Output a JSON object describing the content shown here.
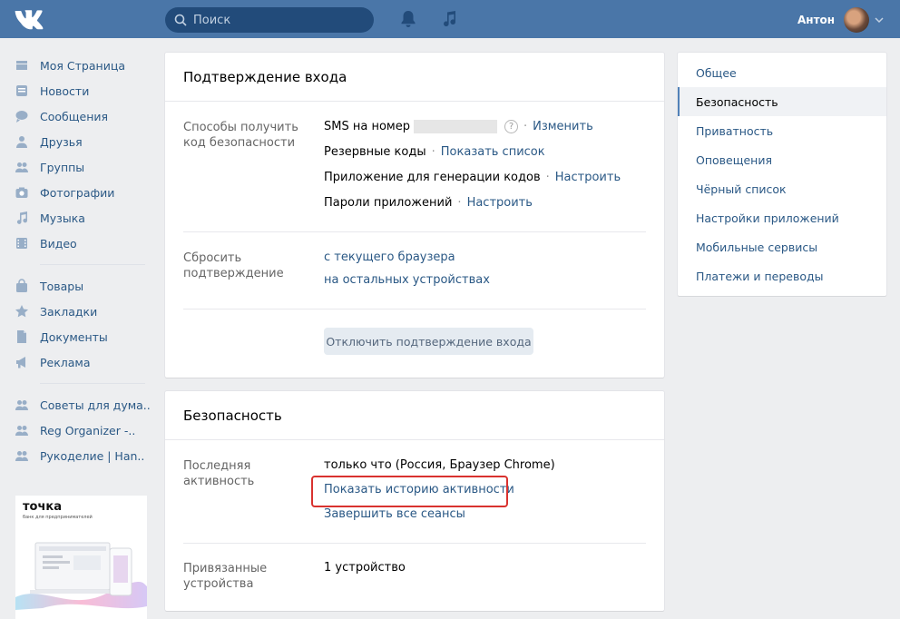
{
  "header": {
    "search_placeholder": "Поиск",
    "user_name": "Антон"
  },
  "leftnav": {
    "group1": [
      {
        "label": "Моя Страница",
        "icon": "home-icon"
      },
      {
        "label": "Новости",
        "icon": "news-icon"
      },
      {
        "label": "Сообщения",
        "icon": "messages-icon"
      },
      {
        "label": "Друзья",
        "icon": "friends-icon"
      },
      {
        "label": "Группы",
        "icon": "groups-icon"
      },
      {
        "label": "Фотографии",
        "icon": "camera-icon"
      },
      {
        "label": "Музыка",
        "icon": "music-icon"
      },
      {
        "label": "Видео",
        "icon": "video-icon"
      }
    ],
    "group2": [
      {
        "label": "Товары",
        "icon": "bag-icon"
      },
      {
        "label": "Закладки",
        "icon": "star-icon"
      },
      {
        "label": "Документы",
        "icon": "document-icon"
      },
      {
        "label": "Реклама",
        "icon": "megaphone-icon"
      }
    ],
    "group3": [
      {
        "label": "Советы для дума..",
        "icon": "group-icon"
      },
      {
        "label": "Reg Organizer -..",
        "icon": "group-icon"
      },
      {
        "label": "Рукоделие | Han..",
        "icon": "group-icon"
      }
    ],
    "ad_brand": "точка",
    "ad_tagline": "банк для предпринимателей"
  },
  "login_confirm": {
    "title": "Подтверждение входа",
    "methods_label": "Способы получить код безопасности",
    "sms_label": "SMS на номер",
    "sms_action": "Изменить",
    "backup_label": "Резервные коды",
    "backup_action": "Показать список",
    "app_label": "Приложение для генерации кодов",
    "app_action": "Настроить",
    "passwords_label": "Пароли приложений",
    "passwords_action": "Настроить",
    "reset_label": "Сбросить подтверждение",
    "reset_current": "с текущего браузера",
    "reset_other": "на остальных устройствах",
    "disable_button": "Отключить подтверждение входа"
  },
  "security": {
    "title": "Безопасность",
    "last_activity_label": "Последняя активность",
    "last_activity_value": "только что (Россия, Браузер Chrome)",
    "show_history": "Показать историю активности",
    "end_sessions": "Завершить все сеансы",
    "devices_label": "Привязанные устройства",
    "devices_value": "1 устройство"
  },
  "right_menu": {
    "items": [
      "Общее",
      "Безопасность",
      "Приватность",
      "Оповещения",
      "Чёрный список",
      "Настройки приложений",
      "Мобильные сервисы",
      "Платежи и переводы"
    ],
    "active_index": 1
  },
  "colors": {
    "header": "#4a76a8",
    "link": "#2a5885",
    "highlight": "#d9322f"
  }
}
